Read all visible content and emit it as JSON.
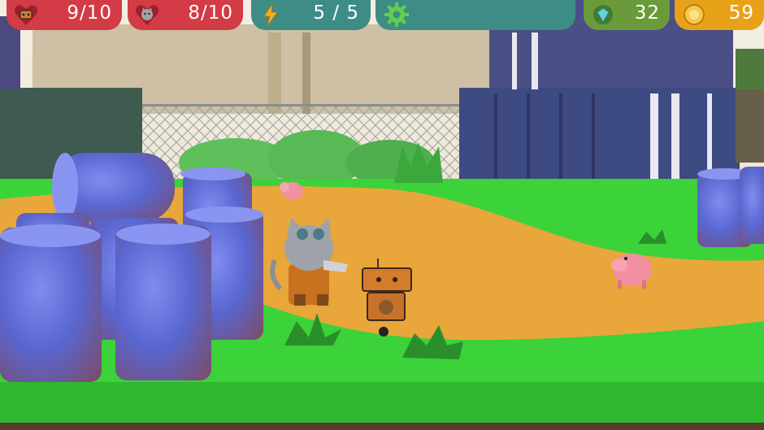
{
  "hud": {
    "robot_health": {
      "icon": "robot-heart-icon",
      "value": "9/10"
    },
    "cat_health": {
      "icon": "cat-heart-icon",
      "value": "8/10"
    },
    "energy": {
      "icon": "lightning-icon",
      "value": "5 / 5"
    },
    "settings": {
      "icon": "gear-icon"
    },
    "gems": {
      "icon": "gem-icon",
      "value": "32"
    },
    "coins": {
      "icon": "coin-icon",
      "value": "59"
    }
  },
  "colors": {
    "health_bar": "#d33b46",
    "energy_bar": "#3e8c86",
    "gems_bar": "#6a9a3a",
    "coins_bar": "#e8a21a",
    "grass": "#3bd23a",
    "path": "#e8a63b",
    "barrel": "#5b6bd6"
  }
}
